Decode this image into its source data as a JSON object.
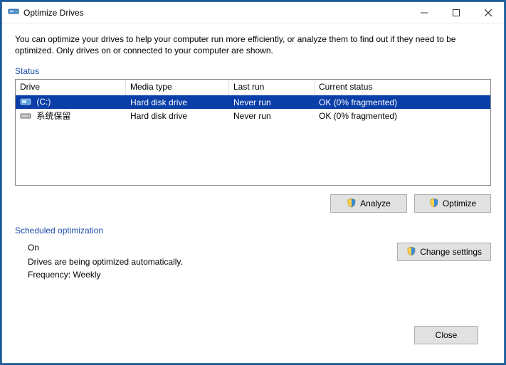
{
  "window": {
    "title": "Optimize Drives"
  },
  "description": "You can optimize your drives to help your computer run more efficiently, or analyze them to find out if they need to be optimized. Only drives on or connected to your computer are shown.",
  "status_label": "Status",
  "columns": {
    "drive": "Drive",
    "media": "Media type",
    "last": "Last run",
    "status": "Current status"
  },
  "rows": [
    {
      "name": "(C:)",
      "media": "Hard disk drive",
      "last": "Never run",
      "status": "OK (0% fragmented)",
      "selected": true
    },
    {
      "name": "系统保留",
      "media": "Hard disk drive",
      "last": "Never run",
      "status": "OK (0% fragmented)",
      "selected": false
    }
  ],
  "buttons": {
    "analyze": "Analyze",
    "optimize": "Optimize",
    "change": "Change settings",
    "close": "Close"
  },
  "scheduled": {
    "label": "Scheduled optimization",
    "state": "On",
    "line1": "Drives are being optimized automatically.",
    "line2": "Frequency: Weekly"
  }
}
